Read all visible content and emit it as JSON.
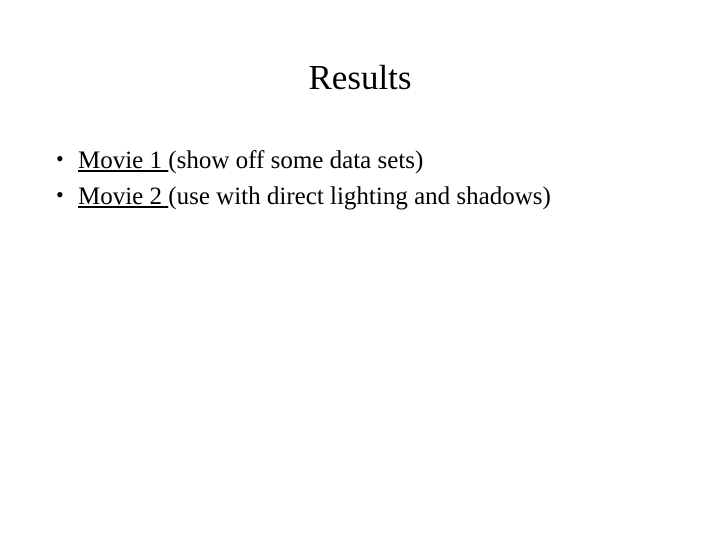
{
  "title": "Results",
  "items": [
    {
      "link": "Movie 1 ",
      "desc": "(show off some data sets)"
    },
    {
      "link": "Movie 2 ",
      "desc": "(use with direct lighting and shadows)"
    }
  ]
}
